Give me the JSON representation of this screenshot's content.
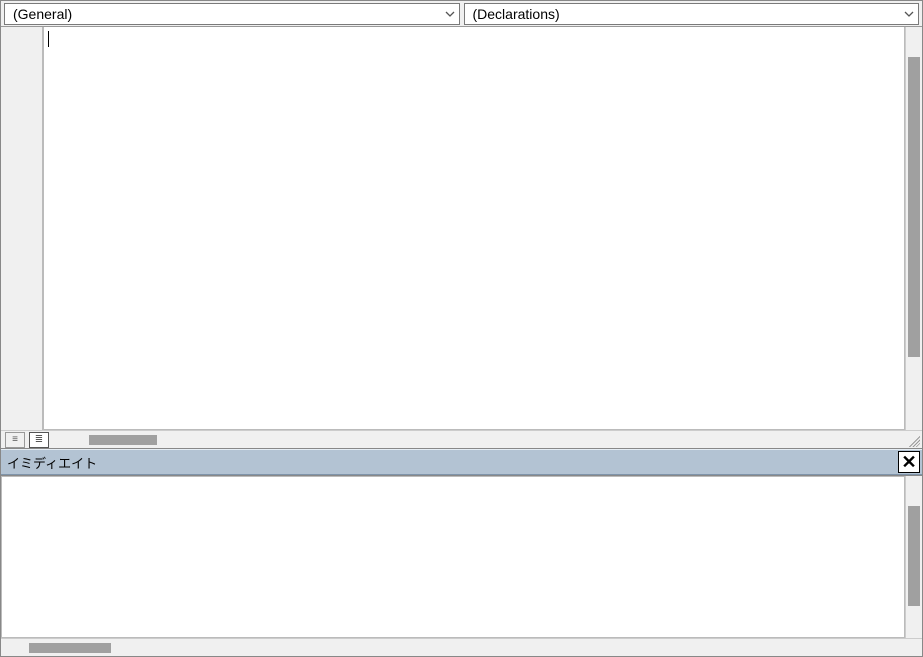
{
  "code_pane": {
    "object_dropdown": {
      "selected": "(General)"
    },
    "procedure_dropdown": {
      "selected": "(Declarations)"
    },
    "content": "",
    "view_buttons": {
      "procedure_view_glyph": "≡",
      "full_view_glyph": "≣"
    }
  },
  "immediate_pane": {
    "title": "イミディエイト",
    "content": "",
    "close_glyph": "✕"
  }
}
